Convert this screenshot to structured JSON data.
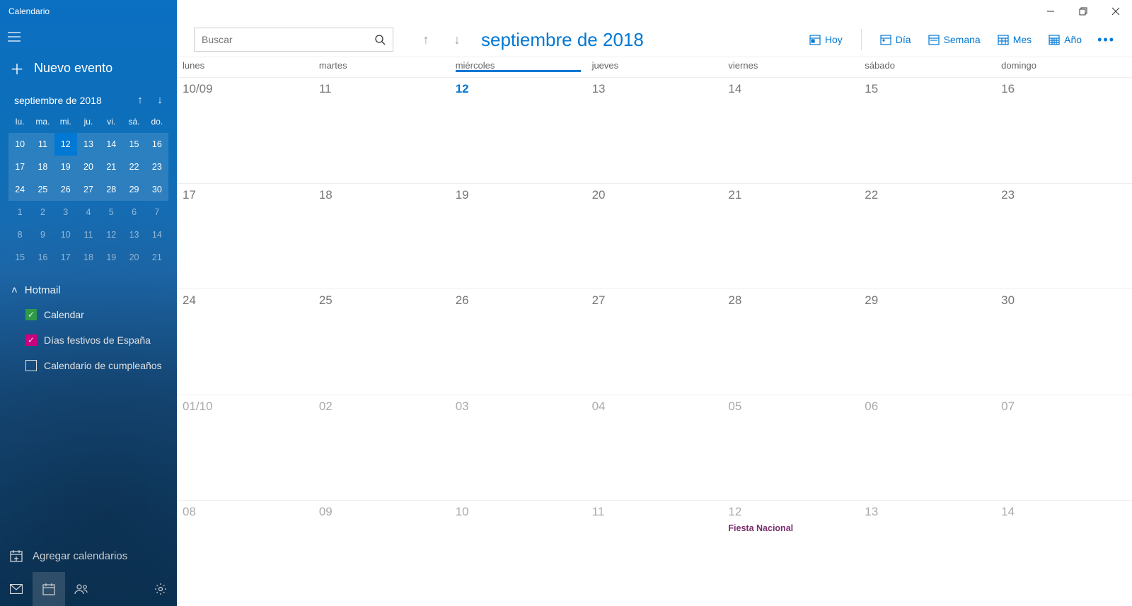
{
  "app_title": "Calendario",
  "new_event_label": "Nuevo evento",
  "mini_month_label": "septiembre de 2018",
  "mini_dow": [
    "lu.",
    "ma.",
    "mi.",
    "ju.",
    "vi.",
    "sá.",
    "do."
  ],
  "mini_weeks": [
    {
      "cls": "cur",
      "days": [
        "10",
        "11",
        "12",
        "13",
        "14",
        "15",
        "16"
      ],
      "today_idx": 2
    },
    {
      "cls": "cur",
      "days": [
        "17",
        "18",
        "19",
        "20",
        "21",
        "22",
        "23"
      ]
    },
    {
      "cls": "cur",
      "days": [
        "24",
        "25",
        "26",
        "27",
        "28",
        "29",
        "30"
      ]
    },
    {
      "cls": "next",
      "days": [
        "1",
        "2",
        "3",
        "4",
        "5",
        "6",
        "7"
      ]
    },
    {
      "cls": "next",
      "days": [
        "8",
        "9",
        "10",
        "11",
        "12",
        "13",
        "14"
      ]
    },
    {
      "cls": "next",
      "days": [
        "15",
        "16",
        "17",
        "18",
        "19",
        "20",
        "21"
      ]
    }
  ],
  "account_name": "Hotmail",
  "calendars": [
    {
      "label": "Calendar",
      "checked": true,
      "color": "c-green"
    },
    {
      "label": "Días festivos de España",
      "checked": true,
      "color": "c-pink"
    },
    {
      "label": "Calendario de cumpleaños",
      "checked": false,
      "color": ""
    }
  ],
  "add_calendars_label": "Agregar calendarios",
  "search_placeholder": "Buscar",
  "main_month_label": "septiembre de 2018",
  "view_buttons": {
    "today": "Hoy",
    "day": "Día",
    "week": "Semana",
    "month": "Mes",
    "year": "Año"
  },
  "dow": [
    "lunes",
    "martes",
    "miércoles",
    "jueves",
    "viernes",
    "sábado",
    "domingo"
  ],
  "today_col": 2,
  "weeks": [
    [
      {
        "n": "10/09",
        "today": false
      },
      {
        "n": "11",
        "today": false
      },
      {
        "n": "12",
        "today": true
      },
      {
        "n": "13",
        "today": false
      },
      {
        "n": "14",
        "today": false
      },
      {
        "n": "15",
        "today": false
      },
      {
        "n": "16",
        "today": false
      }
    ],
    [
      {
        "n": "17"
      },
      {
        "n": "18"
      },
      {
        "n": "19"
      },
      {
        "n": "20"
      },
      {
        "n": "21"
      },
      {
        "n": "22"
      },
      {
        "n": "23"
      }
    ],
    [
      {
        "n": "24"
      },
      {
        "n": "25"
      },
      {
        "n": "26"
      },
      {
        "n": "27"
      },
      {
        "n": "28"
      },
      {
        "n": "29"
      },
      {
        "n": "30"
      }
    ],
    [
      {
        "n": "01/10",
        "out": true
      },
      {
        "n": "02",
        "out": true
      },
      {
        "n": "03",
        "out": true
      },
      {
        "n": "04",
        "out": true
      },
      {
        "n": "05",
        "out": true
      },
      {
        "n": "06",
        "out": true
      },
      {
        "n": "07",
        "out": true
      }
    ],
    [
      {
        "n": "08",
        "out": true
      },
      {
        "n": "09",
        "out": true
      },
      {
        "n": "10",
        "out": true
      },
      {
        "n": "11",
        "out": true
      },
      {
        "n": "12",
        "out": true,
        "event": "Fiesta Nacional"
      },
      {
        "n": "13",
        "out": true
      },
      {
        "n": "14",
        "out": true
      }
    ]
  ]
}
